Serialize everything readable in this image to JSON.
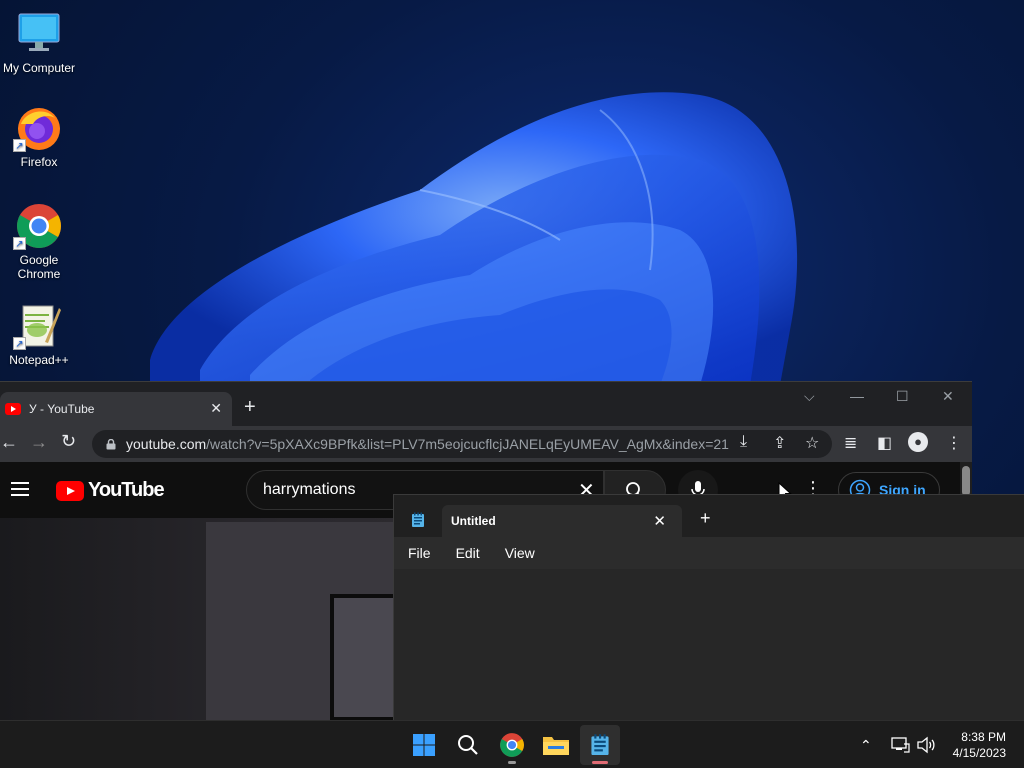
{
  "desktop": {
    "icons": [
      {
        "label": "My Computer",
        "icon": "monitor-icon"
      },
      {
        "label": "Firefox",
        "icon": "firefox-icon"
      },
      {
        "label": "Google Chrome",
        "icon": "chrome-icon"
      },
      {
        "label": "Notepad++",
        "icon": "notepadpp-icon"
      }
    ]
  },
  "chrome": {
    "tab_title": "У - YouTube",
    "url_host": "youtube.com",
    "url_path": "/watch?v=5pXAXc9BPfk&list=PLV7m5eojcucflcjJANELqEyUMEAV_AgMx&index=21",
    "youtube": {
      "logo_text": "YouTube",
      "search_value": "harrymations",
      "signin_label": "Sign in"
    }
  },
  "notepad": {
    "tab_title": "Untitled",
    "menu": [
      "File",
      "Edit",
      "View"
    ]
  },
  "taskbar": {
    "time": "8:38 PM",
    "date": "4/15/2023"
  },
  "colors": {
    "youtube_red": "#ff0000",
    "signin_blue": "#3ea6ff",
    "wallpaper_blue": "#1a5fff"
  }
}
